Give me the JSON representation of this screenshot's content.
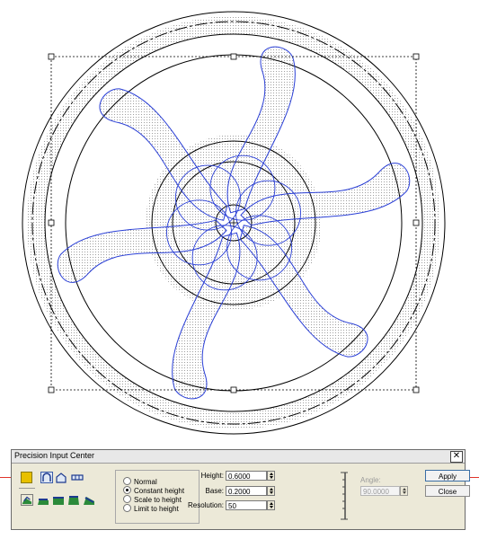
{
  "dialog": {
    "title": "Precision Input Center",
    "close_glyph": "✕",
    "mode_options": [
      {
        "label": "Normal",
        "selected": false
      },
      {
        "label": "Constant height",
        "selected": true
      },
      {
        "label": "Scale to height",
        "selected": false
      },
      {
        "label": "Limit to height",
        "selected": false
      }
    ],
    "fields": {
      "height_label": "Height:",
      "height_value": "0.6000",
      "base_label": "Base:",
      "base_value": "0.2000",
      "resolution_label": "Resolution:",
      "resolution_value": "50",
      "angle_label": "Angle:",
      "angle_value": "90.0000"
    },
    "buttons": {
      "apply": "Apply",
      "close": "Close"
    },
    "icons": [
      "color-swatch-icon",
      "arch-icon",
      "house-icon",
      "bar-icon",
      "shape-icon-1",
      "shape-icon-2",
      "shape-icon-3",
      "shape-icon-4",
      "shape-icon-5",
      "height-ruler-icon"
    ]
  },
  "colors": {
    "spokes": "#2a3fd6",
    "outline": "#000000",
    "hatch": "#9a9a9a",
    "guide_line": "#e0352b",
    "swatch": "#e8c000"
  }
}
